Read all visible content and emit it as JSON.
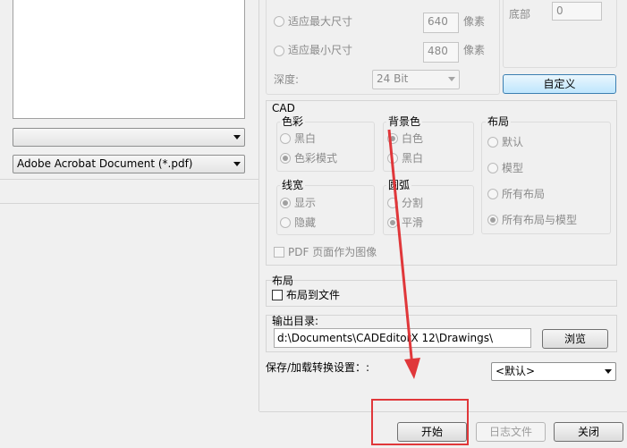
{
  "image_options": {
    "fit_max_label": "适应最大尺寸",
    "fit_max_value": "640",
    "fit_max_unit": "像素",
    "fit_min_label": "适应最小尺寸",
    "fit_min_value": "480",
    "fit_min_unit": "像素",
    "depth_label": "深度:",
    "depth_value": "24 Bit"
  },
  "margins": {
    "bottom_label": "底部",
    "bottom_value": "0",
    "custom_button": "自定义"
  },
  "left_panel": {
    "combo1_value": "",
    "format_value": "Adobe Acrobat Document (*.pdf)"
  },
  "cad": {
    "title": "CAD",
    "color": {
      "title": "色彩",
      "bw": "黑白",
      "color_mode": "色彩模式"
    },
    "background": {
      "title": "背景色",
      "white": "白色",
      "black": "黑白"
    },
    "layout": {
      "title": "布局",
      "default": "默认",
      "model": "模型",
      "all_layouts": "所有布局",
      "all_layouts_model": "所有布局与模型"
    },
    "lineweight": {
      "title": "线宽",
      "show": "显示",
      "hide": "隐藏"
    },
    "arc": {
      "title": "圆弧",
      "split": "分割",
      "smooth": "平滑"
    },
    "pdf_image": "PDF 页面作为图像"
  },
  "layout_section": {
    "title": "布局",
    "layout_to_file": "布局到文件"
  },
  "output": {
    "label": "输出目录:",
    "path": "d:\\Documents\\CADEditorX 12\\Drawings\\",
    "browse": "浏览"
  },
  "settings": {
    "label": "保存/加载转换设置：:",
    "value": "<默认>"
  },
  "buttons": {
    "start": "开始",
    "log": "日志文件",
    "close": "关闭"
  },
  "colors": {
    "highlight": "#e0373a",
    "custom_button_border": "#3c7fb1"
  }
}
